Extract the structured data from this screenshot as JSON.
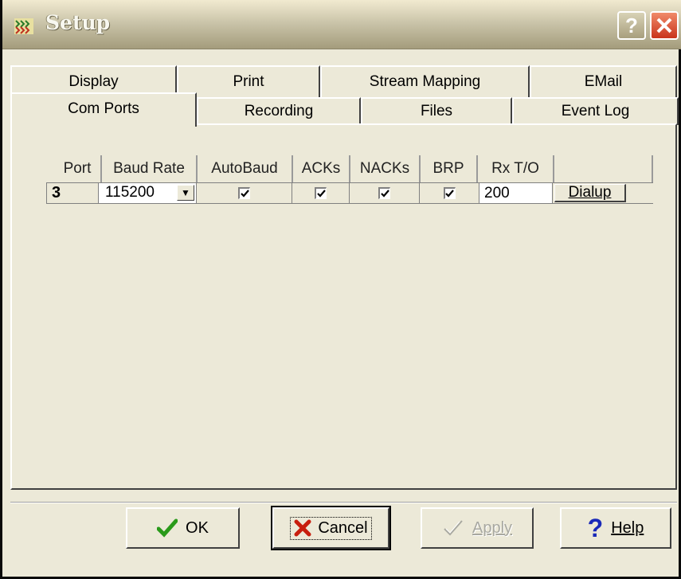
{
  "window": {
    "title": "Setup"
  },
  "tabs_back": [
    {
      "label": "Display"
    },
    {
      "label": "Print"
    },
    {
      "label": "Stream Mapping"
    },
    {
      "label": "EMail"
    }
  ],
  "tabs_front": [
    {
      "label": "Com Ports",
      "active": true
    },
    {
      "label": "Recording"
    },
    {
      "label": "Files"
    },
    {
      "label": "Event Log"
    }
  ],
  "grid": {
    "headers": [
      "Port",
      "Baud Rate",
      "AutoBaud",
      "ACKs",
      "NACKs",
      "BRP",
      "Rx T/O"
    ],
    "row": {
      "port": "3",
      "baud_rate": "115200",
      "autobaud": true,
      "acks": true,
      "nacks": true,
      "brp": true,
      "rx_timeout": "200",
      "dialup_label": "Dialup"
    }
  },
  "buttons": {
    "ok": "OK",
    "cancel": "Cancel",
    "apply": "Apply",
    "help": "Help"
  },
  "colors": {
    "ok_check": "#2a9a1a",
    "cancel_x": "#c81e0e",
    "help_q": "#1a2ab8"
  }
}
